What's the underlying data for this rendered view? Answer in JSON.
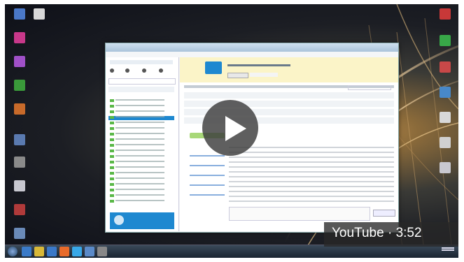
{
  "player": {
    "brand": "YouTube",
    "separator": "·",
    "duration": "3:52"
  },
  "colors": {
    "play_button": "#3c3c3c",
    "badge": "#282828",
    "skype_banner": "#fbf4c8",
    "skype_accent": "#1e88d0"
  },
  "icons": {
    "play": "play-icon"
  }
}
